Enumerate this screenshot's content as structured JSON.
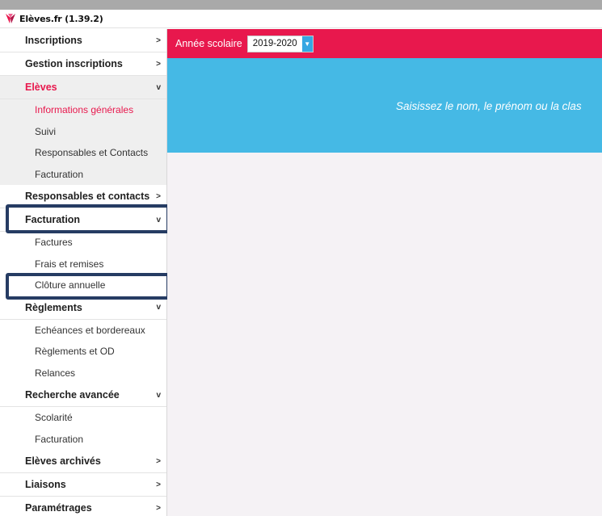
{
  "titlebar": {
    "title": "Elèves.fr (1.39.2)"
  },
  "sidebar": {
    "inscriptions": {
      "label": "Inscriptions",
      "arrow": ">"
    },
    "gestion": {
      "label": "Gestion inscriptions",
      "arrow": ">"
    },
    "eleves": {
      "label": "Elèves",
      "arrow": "v",
      "items": [
        "Informations générales",
        "Suivi",
        "Responsables et Contacts",
        "Facturation"
      ]
    },
    "responsables": {
      "label": "Responsables et contacts",
      "arrow": ">"
    },
    "facturation": {
      "label": "Facturation",
      "arrow": "v",
      "items": [
        "Factures",
        "Frais et remises",
        "Clôture annuelle"
      ]
    },
    "reglements": {
      "label": "Règlements",
      "arrow": "v",
      "items": [
        "Echéances et bordereaux",
        "Règlements et OD",
        "Relances"
      ]
    },
    "recherche": {
      "label": "Recherche avancée",
      "arrow": "v",
      "items": [
        "Scolarité",
        "Facturation"
      ]
    },
    "archives": {
      "label": "Elèves archivés",
      "arrow": ">"
    },
    "liaisons": {
      "label": "Liaisons",
      "arrow": ">"
    },
    "parametrages": {
      "label": "Paramétrages",
      "arrow": ">"
    }
  },
  "main": {
    "year_label": "Année scolaire",
    "year_value": "2019-2020",
    "search_hint": "Saisissez le nom, le prénom ou la clas"
  },
  "colors": {
    "accent": "#e8184d",
    "banner": "#45b9e5",
    "highlight_border": "#263c63"
  }
}
